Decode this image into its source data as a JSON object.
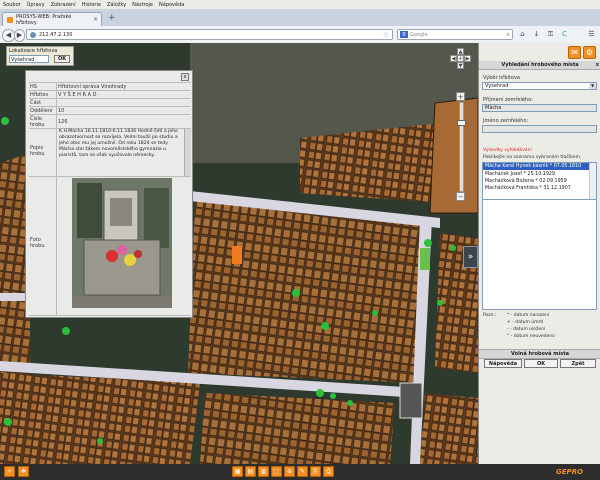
{
  "menubar": [
    "Soubor",
    "Úpravy",
    "Zobrazení",
    "Historie",
    "Záložky",
    "Nástroje",
    "Nápověda"
  ],
  "tab": {
    "title": "PROSYS-WEB: Pražské hřbitovy",
    "new_tab": "+"
  },
  "nav": {
    "back": "◀",
    "forward": "▶",
    "url": "212.47.2.130",
    "search_placeholder": "Google",
    "google_logo": "g",
    "bookmark_star": "☆",
    "search_icon": "⌕",
    "home": "⌂",
    "download": "↓",
    "lock": "⚿",
    "reload": "C",
    "menu": "☰"
  },
  "lokalizace": {
    "label": "Lokalizace hřbitova",
    "value": "Vyšehrad",
    "ok": "OK"
  },
  "popup": {
    "close": "x",
    "rows": [
      {
        "k": "HS",
        "v": "Hřbitovní správa Vinohrady"
      },
      {
        "k": "Hřbitov",
        "v": "V Y Š E H R A D"
      },
      {
        "k": "Část",
        "v": ""
      },
      {
        "k": "Oddělení",
        "v": "10"
      },
      {
        "k": "Číslo hrobu",
        "v": "126"
      }
    ],
    "desc_label": "Popis hrobu",
    "desc_text": "K.H.Mácha 16.11.1810-6.11.1836 Hodně četl a jeho obrazotvornost se rozvíjela. Velmi toužil po studiu a jeho otec mu jej umožnil. Od roku 1824 se tedy Mácha stal žákem novoměstského gymnázia u piaristů, tam se však vyučovalo německy.",
    "photo_label": "Foto hrobu"
  },
  "panel": {
    "title": "Vyhledání hrobového místa",
    "close": "x",
    "cemetery_label": "Výběr hřbitova",
    "cemetery_value": "Vyšehrad",
    "surname_label": "Příjmení zemřelého:",
    "surname_value": "Mácha",
    "firstname_label": "Jméno zemřelého:",
    "firstname_value": "",
    "warn1": "Výsledky vyhledávání",
    "warn2": "Poklikejte na seznamu vybraném tlačíkem.",
    "results": [
      "Mácha Karel Hynek básník  * 07.05.1810",
      "Macháček Josef  * 25.10.1929",
      "Macháčková Božena  * 02.09.1959",
      "Macháčková Františka  * 31.12.1907"
    ],
    "legend_title": "Pozn.:",
    "legend": [
      "* - datum narození",
      "+ - datum úmrtí",
      "- - datum uložení",
      "° - datum neuvedeno"
    ],
    "volna": "Volná hrobová místa",
    "btn_help": "Nápověda",
    "btn_ok": "OK",
    "btn_back": "Zpět"
  },
  "map_controls": {
    "up": "▲",
    "down": "▼",
    "left": "◀",
    "right": "▶",
    "center": "✛",
    "zoom_in": "+",
    "zoom_out": "−",
    "expand": "»"
  },
  "bottom": {
    "logo": "GEPRO",
    "buttons": [
      "+",
      "✥",
      "▦",
      "▤",
      "▥",
      "⬚",
      "⊕",
      "✎",
      "⎘",
      "⎙"
    ]
  }
}
